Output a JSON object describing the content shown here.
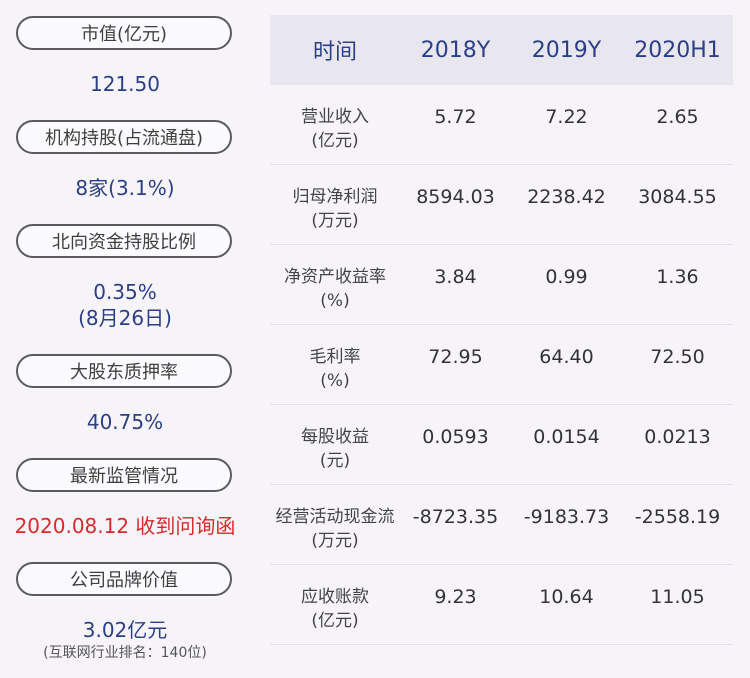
{
  "left": {
    "items": [
      {
        "label": "市值(亿元)",
        "value": "121.50"
      },
      {
        "label": "机构持股(占流通盘)",
        "value": "8家(3.1%)"
      },
      {
        "label": "北向资金持股比例",
        "value": "0.35%",
        "value2": "(8月26日)"
      },
      {
        "label": "大股东质押率",
        "value": "40.75%"
      },
      {
        "label": "最新监管情况",
        "value": "2020.08.12 收到问询函"
      },
      {
        "label": "公司品牌价值",
        "value": "3.02亿元",
        "note": "(互联网行业排名：140位)"
      }
    ]
  },
  "table": {
    "header": [
      "时间",
      "2018Y",
      "2019Y",
      "2020H1"
    ],
    "rows": [
      {
        "label": "营业收入",
        "unit": "(亿元)",
        "values": [
          "5.72",
          "7.22",
          "2.65"
        ]
      },
      {
        "label": "归母净利润",
        "unit": "(万元)",
        "values": [
          "8594.03",
          "2238.42",
          "3084.55"
        ]
      },
      {
        "label": "净资产收益率",
        "unit": "(%)",
        "values": [
          "3.84",
          "0.99",
          "1.36"
        ]
      },
      {
        "label": "毛利率",
        "unit": "(%)",
        "values": [
          "72.95",
          "64.40",
          "72.50"
        ]
      },
      {
        "label": "每股收益",
        "unit": "(元)",
        "values": [
          "0.0593",
          "0.0154",
          "0.0213"
        ]
      },
      {
        "label": "经营活动现金流",
        "unit": "(万元)",
        "values": [
          "-8723.35",
          "-9183.73",
          "-2558.19"
        ]
      },
      {
        "label": "应收账款",
        "unit": "(亿元)",
        "values": [
          "9.23",
          "10.64",
          "11.05"
        ]
      }
    ]
  }
}
